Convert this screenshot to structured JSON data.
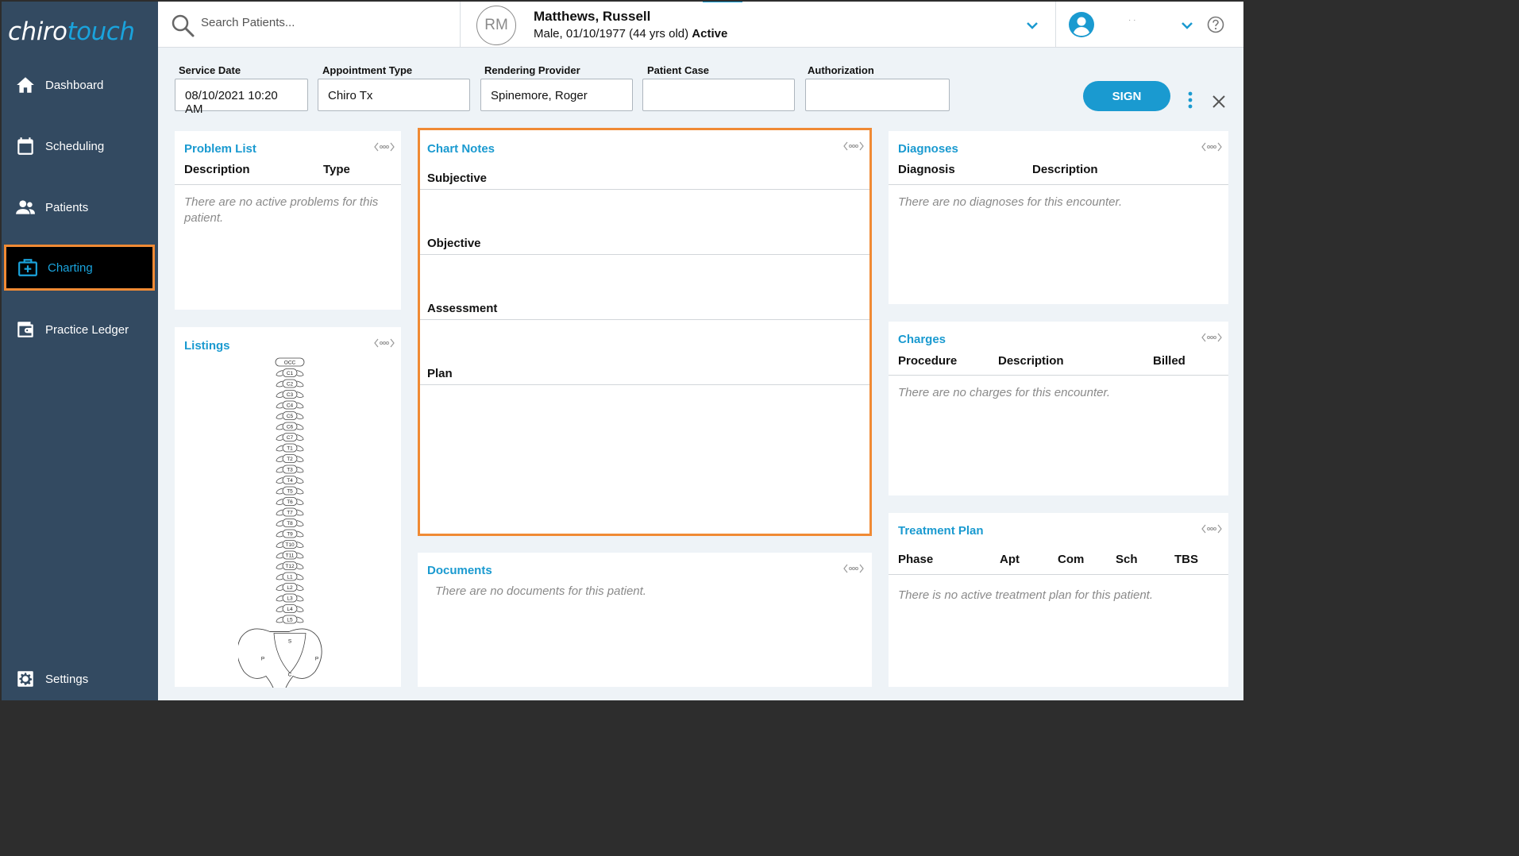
{
  "logo": {
    "part1": "chiro",
    "part2": "touch"
  },
  "sidebar": {
    "items": [
      {
        "label": "Dashboard",
        "icon": "home-icon"
      },
      {
        "label": "Scheduling",
        "icon": "calendar-icon"
      },
      {
        "label": "Patients",
        "icon": "patients-icon"
      },
      {
        "label": "Charting",
        "icon": "medical-kit-icon",
        "active": true
      },
      {
        "label": "Practice Ledger",
        "icon": "wallet-icon"
      },
      {
        "label": "Settings",
        "icon": "gear-icon"
      }
    ]
  },
  "header": {
    "search_placeholder": "Search Patients...",
    "patient_initials": "RM",
    "patient_name": "Matthews, Russell",
    "patient_info": "Male, 01/10/1977 (44 yrs old)",
    "patient_status": "Active",
    "user_name": "· ·"
  },
  "form": {
    "service_date_label": "Service Date",
    "service_date_value": "08/10/2021 10:20 AM",
    "appointment_type_label": "Appointment Type",
    "appointment_type_value": "Chiro Tx",
    "rendering_provider_label": "Rendering Provider",
    "rendering_provider_value": "Spinemore, Roger",
    "patient_case_label": "Patient Case",
    "patient_case_value": "",
    "authorization_label": "Authorization",
    "authorization_value": "",
    "sign_label": "SIGN"
  },
  "problem_list": {
    "title": "Problem List",
    "columns": [
      "Description",
      "Type"
    ],
    "empty": "There are no active problems for this patient."
  },
  "listings": {
    "title": "Listings",
    "vertebrae": [
      "OCC",
      "C1",
      "C2",
      "C3",
      "C4",
      "C5",
      "C6",
      "C7",
      "T1",
      "T2",
      "T3",
      "T4",
      "T5",
      "T6",
      "T7",
      "T8",
      "T9",
      "T10",
      "T11",
      "T12",
      "L1",
      "L2",
      "L3",
      "L4",
      "L5"
    ],
    "pelvis_labels": [
      "S",
      "P",
      "P",
      "C"
    ]
  },
  "chart_notes": {
    "title": "Chart Notes",
    "sections": [
      "Subjective",
      "Objective",
      "Assessment",
      "Plan"
    ]
  },
  "documents": {
    "title": "Documents",
    "empty": "There are no documents for this patient."
  },
  "diagnoses": {
    "title": "Diagnoses",
    "columns": [
      "Diagnosis",
      "Description"
    ],
    "empty": "There are no diagnoses for this encounter."
  },
  "charges": {
    "title": "Charges",
    "columns": [
      "Procedure",
      "Description",
      "Billed"
    ],
    "empty": "There are no charges for this encounter."
  },
  "treatment_plan": {
    "title": "Treatment Plan",
    "columns": [
      "Phase",
      "Apt",
      "Com",
      "Sch",
      "TBS"
    ],
    "empty": "There is no active treatment plan for this patient."
  },
  "colors": {
    "sidebar": "#334a61",
    "accent": "#1a9ad0",
    "highlight": "#f08a34"
  }
}
